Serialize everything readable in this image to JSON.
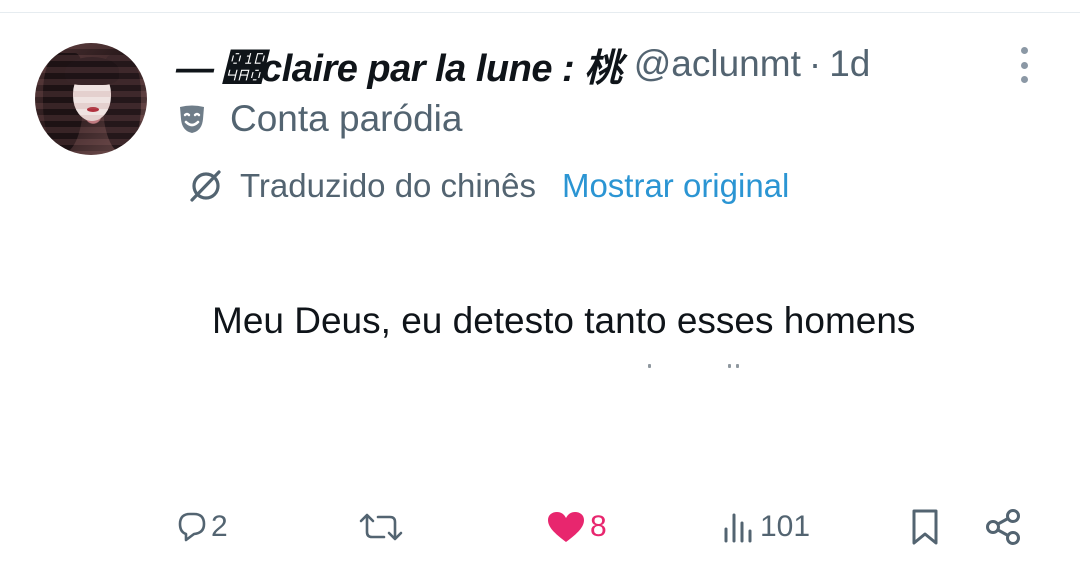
{
  "tweet": {
    "display_name": "— 𝒠claire par la lune : 桃",
    "handle": "@aclunmt",
    "separator": "·",
    "time": "1d",
    "parody_label": "Conta paródia",
    "translated_label": "Traduzido do chinês",
    "show_original_label": "Mostrar original",
    "text": "Meu Deus, eu detesto tanto esses homens"
  },
  "actions": {
    "replies": "2",
    "reposts": "",
    "likes": "8",
    "views": "101"
  },
  "icons": {
    "more": "more-vertical-icon",
    "parody": "parody-mask-icon",
    "translate": "translate-icon",
    "reply": "reply-icon",
    "repost": "repost-icon",
    "like": "heart-icon",
    "views": "views-icon",
    "bookmark": "bookmark-icon",
    "share": "share-icon"
  },
  "colors": {
    "link": "#2b95d3",
    "like": "#e8266e",
    "secondary_text": "#536471",
    "primary_text": "#0f1419"
  }
}
